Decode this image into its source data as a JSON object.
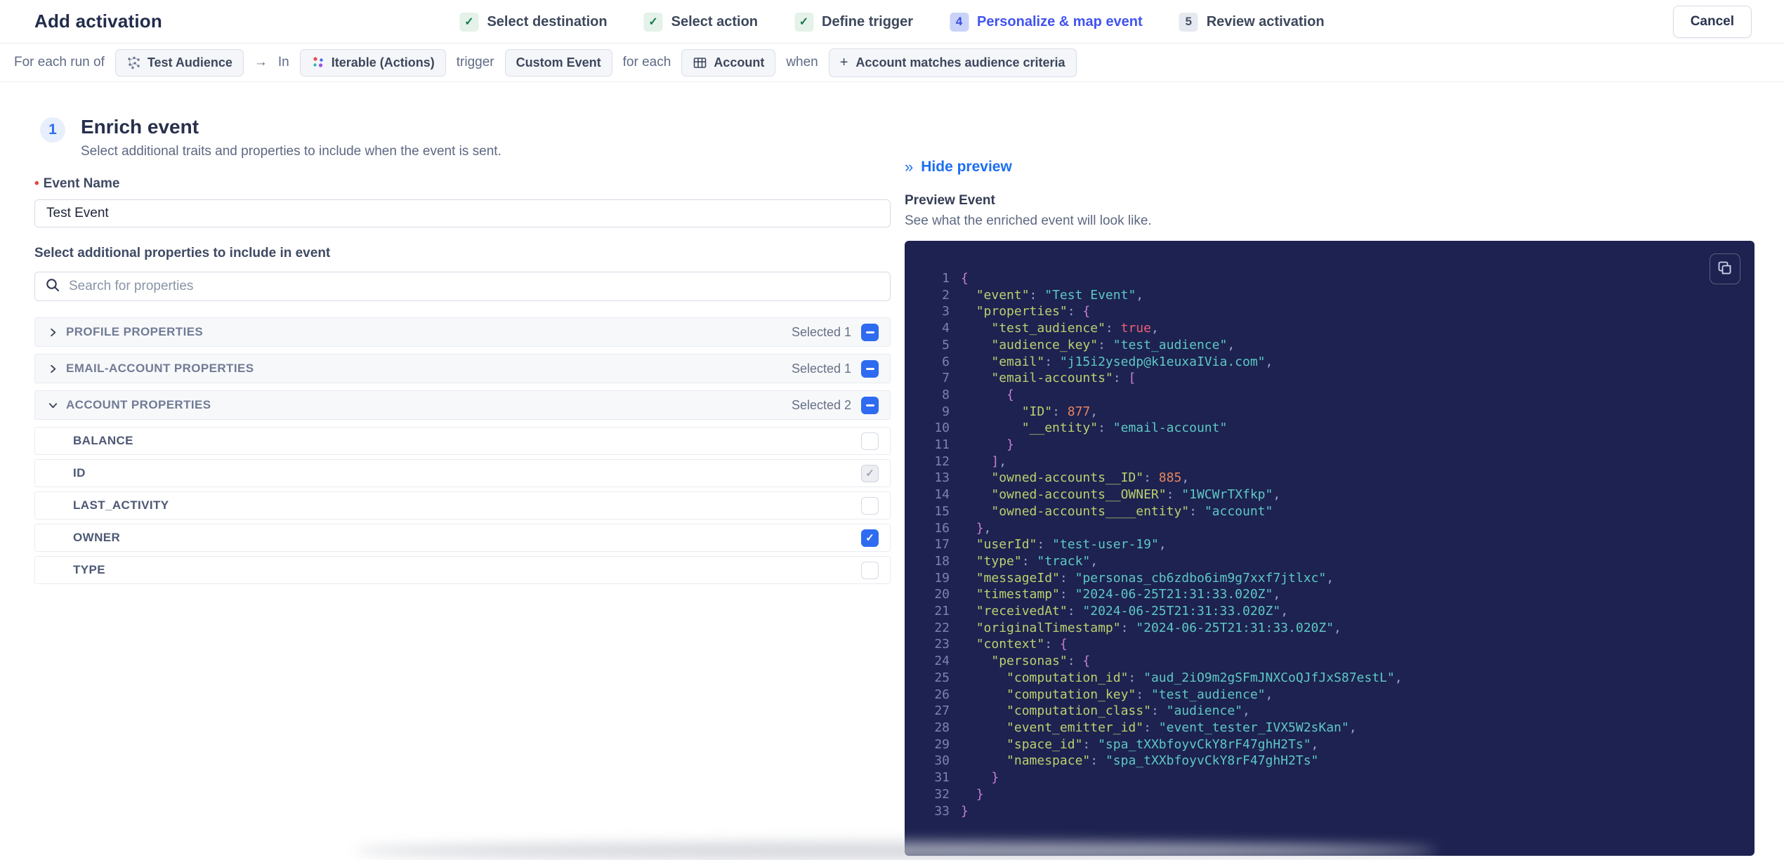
{
  "header": {
    "title": "Add activation",
    "cancel_label": "Cancel",
    "steps": [
      {
        "label": "Select destination",
        "state": "done"
      },
      {
        "label": "Select action",
        "state": "done"
      },
      {
        "label": "Define trigger",
        "state": "done"
      },
      {
        "label": "Personalize & map event",
        "state": "active",
        "number": "4"
      },
      {
        "label": "Review activation",
        "state": "upcoming",
        "number": "5"
      }
    ]
  },
  "trigger_bar": {
    "segments": [
      {
        "type": "text",
        "text": "For each run of"
      },
      {
        "type": "chip",
        "icon": "audience-icon",
        "text": "Test Audience"
      },
      {
        "type": "text",
        "text": "→"
      },
      {
        "type": "text",
        "text": "In"
      },
      {
        "type": "chip",
        "icon": "iterable-icon",
        "text": "Iterable (Actions)"
      },
      {
        "type": "text",
        "text": "trigger"
      },
      {
        "type": "chip",
        "text": "Custom Event"
      },
      {
        "type": "text",
        "text": "for each"
      },
      {
        "type": "chip",
        "icon": "table-icon",
        "text": "Account"
      },
      {
        "type": "text",
        "text": "when"
      },
      {
        "type": "chip",
        "icon": "plus-icon",
        "text": "Account matches audience criteria"
      }
    ]
  },
  "enrich": {
    "step_number": "1",
    "title": "Enrich event",
    "subtitle": "Select additional traits and properties to include when the event is sent.",
    "event_name_label": "Event Name",
    "event_name_value": "Test Event",
    "properties_label": "Select additional properties to include in event",
    "search_placeholder": "Search for properties",
    "groups": [
      {
        "label": "PROFILE PROPERTIES",
        "selected_text": "Selected 1",
        "expanded": false
      },
      {
        "label": "EMAIL-ACCOUNT PROPERTIES",
        "selected_text": "Selected 1",
        "expanded": false
      },
      {
        "label": "ACCOUNT PROPERTIES",
        "selected_text": "Selected 2",
        "expanded": true
      }
    ],
    "account_properties": [
      {
        "label": "BALANCE",
        "state": "unchecked"
      },
      {
        "label": "ID",
        "state": "checked-disabled"
      },
      {
        "label": "LAST_ACTIVITY",
        "state": "unchecked"
      },
      {
        "label": "OWNER",
        "state": "checked"
      },
      {
        "label": "TYPE",
        "state": "unchecked"
      }
    ]
  },
  "preview": {
    "hide_label": "Hide preview",
    "title": "Preview Event",
    "subtitle": "See what the enriched event will look like.",
    "code_lines": [
      "{",
      "  \"event\": \"Test Event\",",
      "  \"properties\": {",
      "    \"test_audience\": true,",
      "    \"audience_key\": \"test_audience\",",
      "    \"email\": \"j15i2ysedp@k1euxaIVia.com\",",
      "    \"email-accounts\": [",
      "      {",
      "        \"ID\": 877,",
      "        \"__entity\": \"email-account\"",
      "      }",
      "    ],",
      "    \"owned-accounts__ID\": 885,",
      "    \"owned-accounts__OWNER\": \"1WCWrTXfkp\",",
      "    \"owned-accounts____entity\": \"account\"",
      "  },",
      "  \"userId\": \"test-user-19\",",
      "  \"type\": \"track\",",
      "  \"messageId\": \"personas_cb6zdbo6im9g7xxf7jtlxc\",",
      "  \"timestamp\": \"2024-06-25T21:31:33.020Z\",",
      "  \"receivedAt\": \"2024-06-25T21:31:33.020Z\",",
      "  \"originalTimestamp\": \"2024-06-25T21:31:33.020Z\",",
      "  \"context\": {",
      "    \"personas\": {",
      "      \"computation_id\": \"aud_2iO9m2gSFmJNXCoQJfJxS87estL\",",
      "      \"computation_key\": \"test_audience\",",
      "      \"computation_class\": \"audience\",",
      "      \"event_emitter_id\": \"event_tester_IVX5W2sKan\",",
      "      \"space_id\": \"spa_tXXbfoyvCkY8rF47ghH2Ts\",",
      "      \"namespace\": \"spa_tXXbfoyvCkY8rF47ghH2Ts\"",
      "    }",
      "  }",
      "}"
    ]
  },
  "icons": {
    "check": "✓",
    "chevrons_right": "»",
    "plus": "+"
  },
  "colors": {
    "accent_blue": "#2e6bf0",
    "active_step_blue": "#4053f0",
    "link_blue": "#1d6ff2",
    "success_green": "#157a47",
    "required_red": "#e0483e",
    "code_background": "#1d2250",
    "code_key": "#bccf6f",
    "code_string": "#5ec8c4",
    "code_number": "#e8855d",
    "code_boolean": "#ee5f74",
    "code_brace": "#c97fd4"
  }
}
